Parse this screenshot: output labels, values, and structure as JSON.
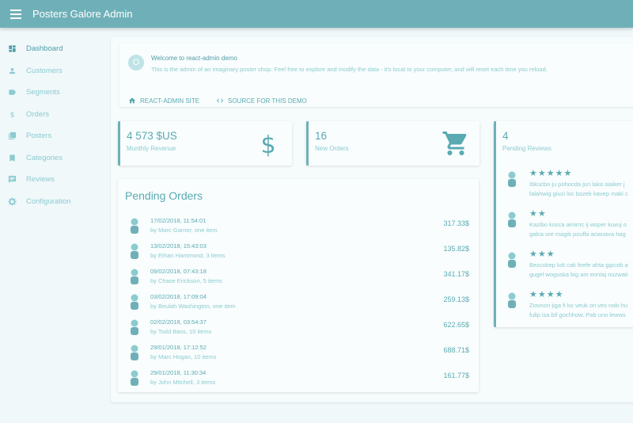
{
  "appbar": {
    "title": "Posters Galore Admin"
  },
  "sidebar": {
    "items": [
      {
        "label": "Dashboard",
        "icon": "dashboard-icon"
      },
      {
        "label": "Customers",
        "icon": "person-icon"
      },
      {
        "label": "Segments",
        "icon": "label-icon"
      },
      {
        "label": "Orders",
        "icon": "dollar-icon"
      },
      {
        "label": "Posters",
        "icon": "collections-icon"
      },
      {
        "label": "Categories",
        "icon": "bookmark-icon"
      },
      {
        "label": "Reviews",
        "icon": "comment-icon"
      },
      {
        "label": "Configuration",
        "icon": "gear-icon"
      }
    ]
  },
  "welcome": {
    "avatar_letter": "O",
    "title": "Welcome to react-admin demo",
    "text": "This is the admin of an imaginary poster shop. Feel free to explore and modify the data - it's local to your computer, and will reset each time you reload.",
    "site_link": "REACT-ADMIN SITE",
    "source_link": "SOURCE FOR THIS DEMO"
  },
  "stats": {
    "revenue": {
      "value": "4 573 $US",
      "label": "Monthly Revenue"
    },
    "new_orders": {
      "value": "16",
      "label": "New Orders"
    },
    "pending_reviews": {
      "value": "4",
      "label": "Pending Reviews"
    }
  },
  "pending_orders": {
    "title": "Pending Orders",
    "rows": [
      {
        "date": "17/02/2018, 11:54:01",
        "by": "by Marc Garner, one item",
        "total": "317.33$"
      },
      {
        "date": "13/02/2018, 15:43:03",
        "by": "by Ethan Hammond, 3 items",
        "total": "135.82$"
      },
      {
        "date": "09/02/2018, 07:43:18",
        "by": "by Chase Erickson, 5 items",
        "total": "341.17$"
      },
      {
        "date": "03/02/2018, 17:09:04",
        "by": "by Beulah Washington, one item",
        "total": "259.13$"
      },
      {
        "date": "02/02/2018, 03:54:37",
        "by": "by Todd Bass, 10 items",
        "total": "622.65$"
      },
      {
        "date": "29/01/2018, 17:12:52",
        "by": "by Marc Hogan, 10 items",
        "total": "688.71$"
      },
      {
        "date": "29/01/2018, 11:30:34",
        "by": "by John Mitchell, 3 items",
        "total": "161.77$"
      }
    ]
  },
  "reviews": [
    {
      "stars": "★★★★★",
      "line1": "Ibkucbo ju pohocda jun laka siaiker j",
      "line2": "falahwig giuzi loc bozek kavep maki c"
    },
    {
      "stars": "★★",
      "line1": "Kazibo kosca amirnc ij woper kuvuj o",
      "line2": "galca ore magik poufbi acwuava hag"
    },
    {
      "stars": "★★★",
      "line1": "Bezcokep lutt cak feefe ahta gipcob a",
      "line2": "gugel woguska big am eontaj nuzwati"
    },
    {
      "stars": "★★★★",
      "line1": "Ziovcon jiga fi ko veuk on ves noki hu",
      "line2": "fulip isa bif gochhow. Pab uno lewws"
    }
  ],
  "colors": {
    "appbar": "#6fb0b8",
    "accent": "#5aaab2",
    "muted": "#8ccbd0",
    "background": "#f0f8fa"
  }
}
